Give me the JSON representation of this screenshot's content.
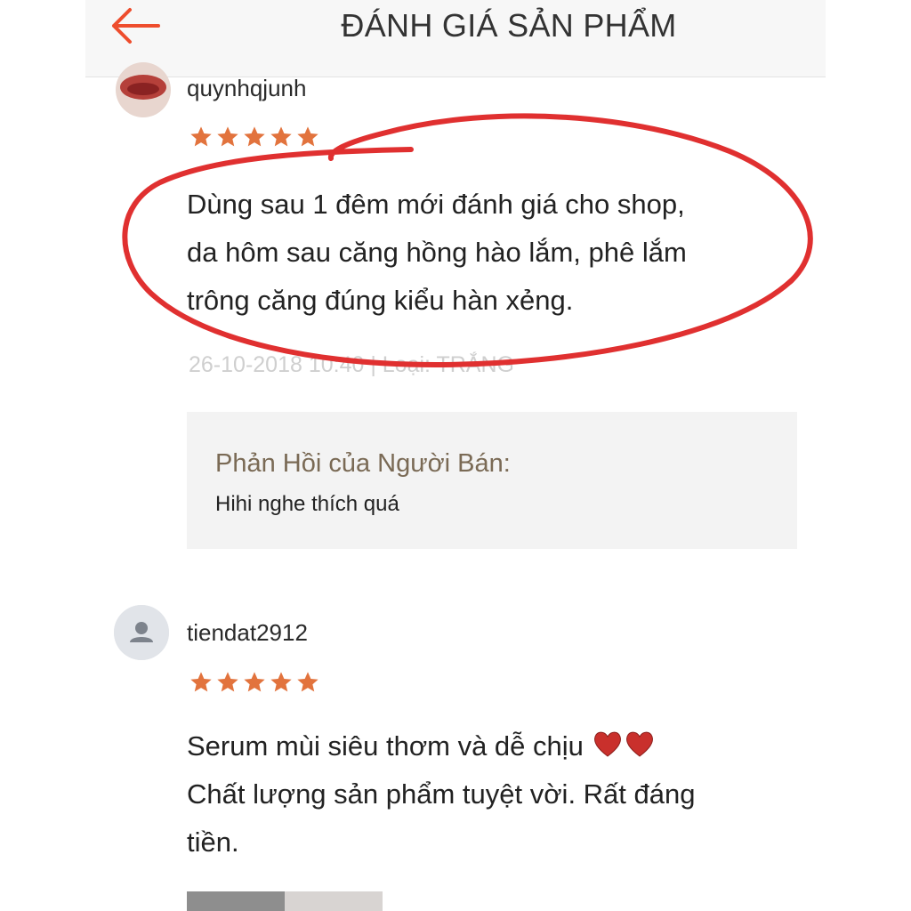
{
  "header": {
    "title": "ĐÁNH GIÁ SẢN PHẨM",
    "back_icon": "arrow-left-icon"
  },
  "colors": {
    "accent": "#ee4d2d",
    "star": "#e2733d",
    "annotation": "#e03030",
    "seller_box_bg": "#f3f3f3"
  },
  "reviews": [
    {
      "username": "quynhqjunh",
      "rating": 5,
      "text_lines": [
        "Dùng sau 1 đêm mới đánh giá cho shop,",
        "da hôm sau căng hồng hào lắm, phê lắm",
        "trông căng đúng kiểu hàn xẻng."
      ],
      "meta": "26-10-2018 10:40 | Loại: TRẮNG",
      "seller_reply": {
        "title": "Phản Hồi của Người Bán:",
        "text": "Hihi nghe thích quá"
      }
    },
    {
      "username": "tiendat2912",
      "rating": 5,
      "text_lines": [
        "Serum mùi siêu thơm và dễ chịu",
        "Chất lượng sản phẩm tuyệt vời. Rất đáng",
        "tiền."
      ]
    }
  ]
}
